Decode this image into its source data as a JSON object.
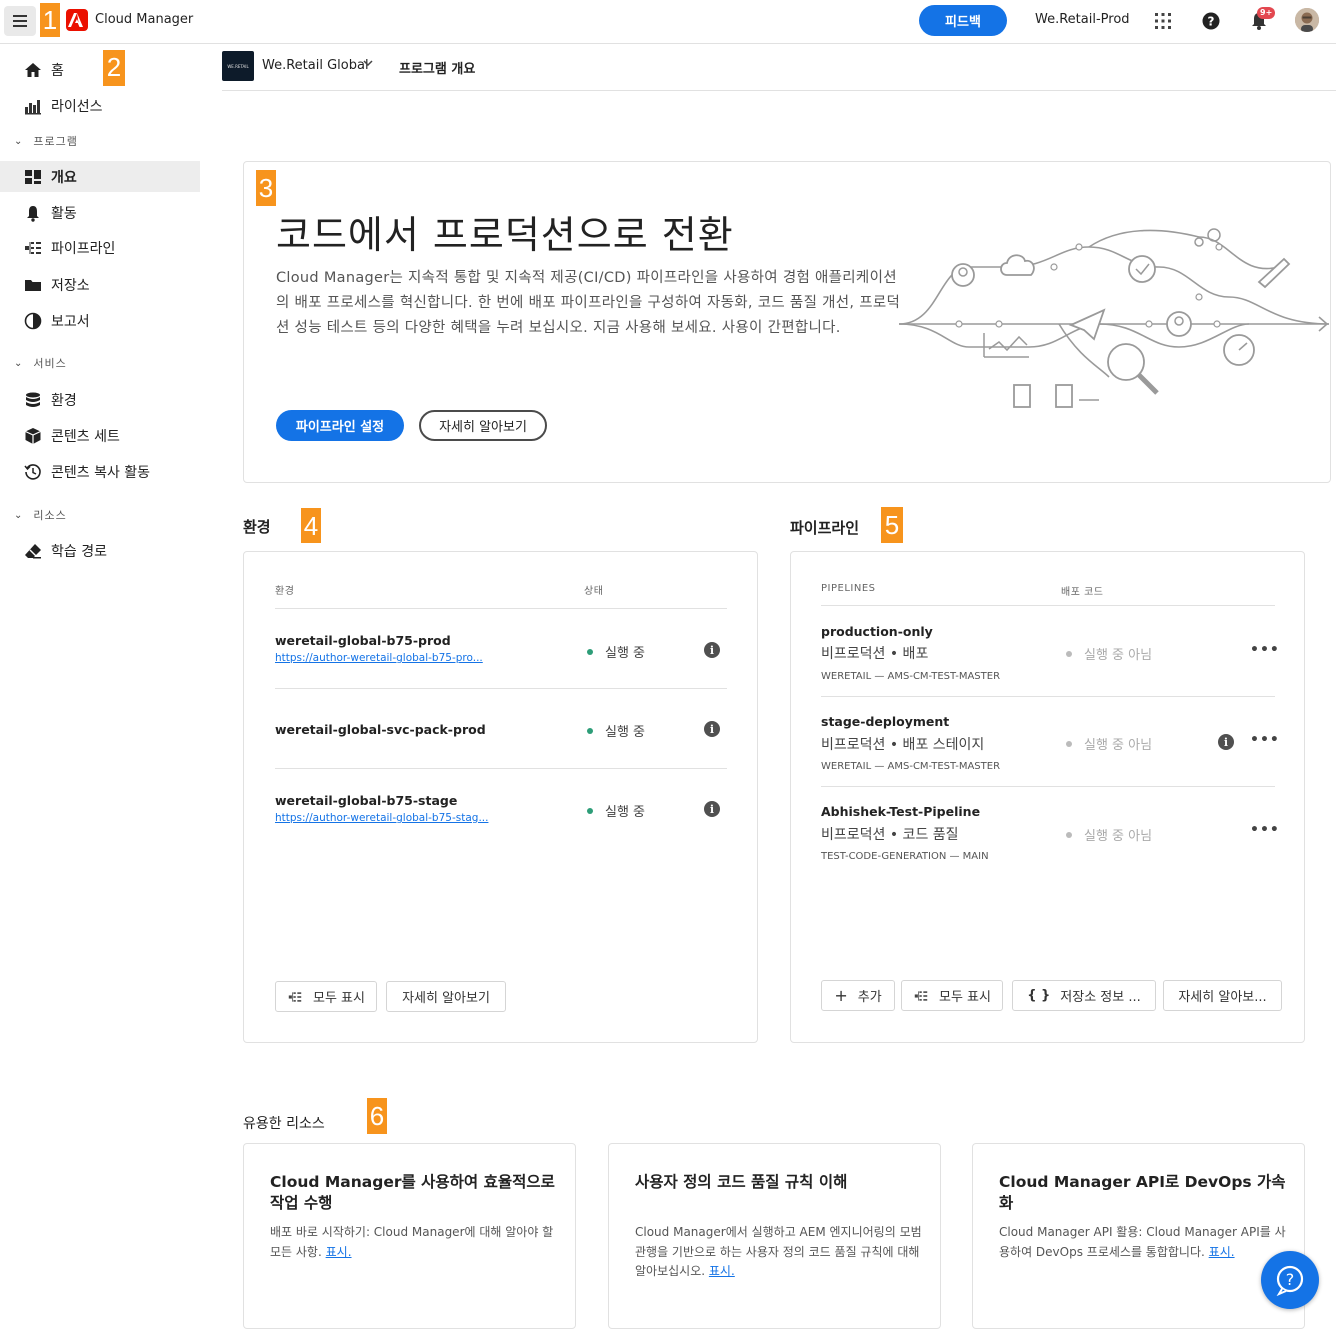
{
  "topbar": {
    "app_title": "Cloud Manager",
    "feedback_label": "피드백",
    "org_name": "We.Retail-Prod",
    "notification_count": "9+"
  },
  "markers": [
    "1",
    "2",
    "3",
    "4",
    "5",
    "6"
  ],
  "sidebar": {
    "items": [
      {
        "label": "홈",
        "icon": "home-icon"
      },
      {
        "label": "라이선스",
        "icon": "license-icon"
      }
    ],
    "sections": [
      {
        "label": "프로그램",
        "items": [
          {
            "label": "개요",
            "icon": "dashboard-icon"
          },
          {
            "label": "활동",
            "icon": "bell-icon"
          },
          {
            "label": "파이프라인",
            "icon": "pipeline-icon"
          },
          {
            "label": "저장소",
            "icon": "folder-icon"
          },
          {
            "label": "보고서",
            "icon": "pie-chart-icon"
          }
        ]
      },
      {
        "label": "서비스",
        "items": [
          {
            "label": "환경",
            "icon": "database-icon"
          },
          {
            "label": "콘텐츠 세트",
            "icon": "box-icon"
          },
          {
            "label": "콘텐츠 복사 활동",
            "icon": "history-icon"
          }
        ]
      },
      {
        "label": "리소스",
        "items": [
          {
            "label": "학습 경로",
            "icon": "eraser-icon"
          }
        ]
      }
    ]
  },
  "program": {
    "name": "We.Retail Global",
    "thumb_text": "WE.RETAIL",
    "page_title": "프로그램 개요"
  },
  "hero": {
    "title": "코드에서 프로덕션으로 전환",
    "description": "Cloud Manager는 지속적 통합 및 지속적 제공(CI/CD) 파이프라인을 사용하여 경험 애플리케이션의 배포 프로세스를 혁신합니다. 한 번에 배포 파이프라인을 구성하여 자동화, 코드 품질 개선, 프로덕션 성능 테스트 등의 다양한 혜택을 누려 보십시오. 지금 사용해 보세요. 사용이 간편합니다.",
    "primary_btn": "파이프라인 설정",
    "secondary_btn": "자세히 알아보기"
  },
  "environments": {
    "section_title": "환경",
    "col_env": "환경",
    "col_status": "상태",
    "rows": [
      {
        "name": "weretail-global-b75-prod",
        "link": "https://author-weretail-global-b75-pro...",
        "status": "실행 중"
      },
      {
        "name": "weretail-global-svc-pack-prod",
        "link": "",
        "status": "실행 중"
      },
      {
        "name": "weretail-global-b75-stage",
        "link": "https://author-weretail-global-b75-stag...",
        "status": "실행 중"
      }
    ],
    "show_all": "모두 표시",
    "learn_more": "자세히 알아보기",
    "status_color": "#2d9d78"
  },
  "pipelines": {
    "section_title": "파이프라인",
    "col_pipelines": "PIPELINES",
    "col_deploy": "배포 코드",
    "rows": [
      {
        "name": "production-only",
        "type": "비프로덕션 • 배포",
        "repo": "WERETAIL — AMS-CM-TEST-MASTER",
        "status": "실행 중 아님"
      },
      {
        "name": "stage-deployment",
        "type": "비프로덕션 • 배포 스테이지",
        "repo": "WERETAIL — AMS-CM-TEST-MASTER",
        "status": "실행 중 아님"
      },
      {
        "name": "Abhishek-Test-Pipeline",
        "type": "비프로덕션 • 코드 품질",
        "repo": "TEST-CODE-GENERATION — MAIN",
        "status": "실행 중 아님"
      }
    ],
    "add": "추가",
    "show_all": "모두 표시",
    "repo_info": "저장소 정보 ...",
    "learn_more": "자세히 알아보..."
  },
  "resources": {
    "section_title": "유용한 리소스",
    "cards": [
      {
        "title": "Cloud Manager를 사용하여 효율적으로 작업 수행",
        "desc": "배포 바로 시작하기: Cloud Manager에 대해 알아야 할 모든 사항.",
        "link": "표시."
      },
      {
        "title": "사용자 정의 코드 품질 규칙 이해",
        "desc": "Cloud Manager에서 실행하고 AEM 엔지니어링의 모범 관행을 기반으로 하는 사용자 정의 코드 품질 규칙에 대해 알아보십시오.",
        "link": "표시."
      },
      {
        "title": "Cloud Manager API로 DevOps 가속화",
        "desc": "Cloud Manager API 활용: Cloud Manager API를 사용하여 DevOps 프로세스를 통합합니다.",
        "link": "표시."
      }
    ]
  },
  "colors": {
    "accent": "#1473e6",
    "marker": "#f7941d",
    "adobe_red": "#eb1000"
  }
}
